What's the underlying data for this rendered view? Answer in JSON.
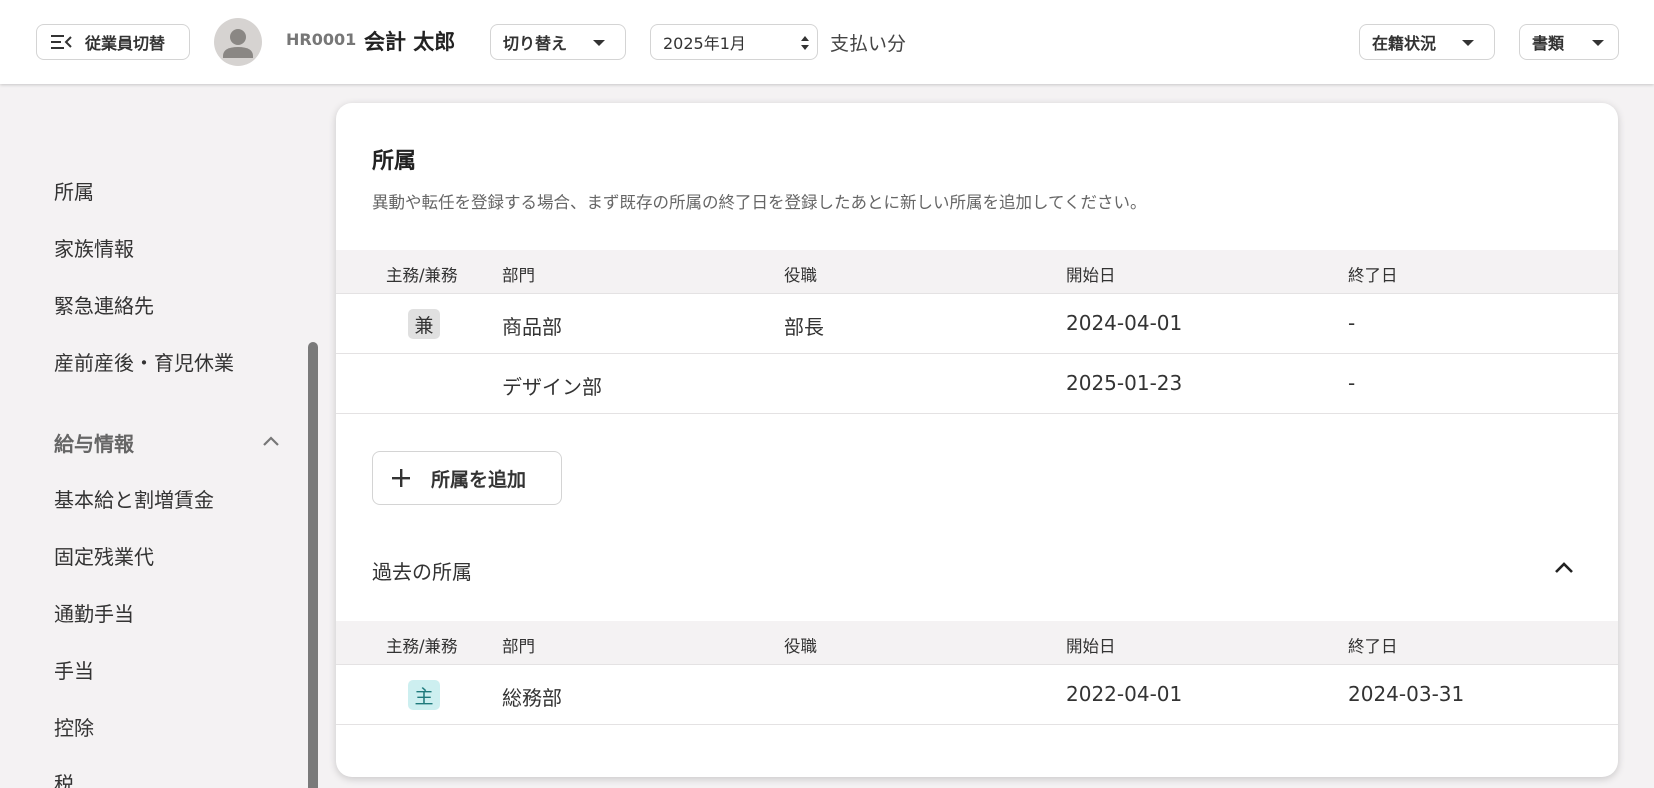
{
  "header": {
    "switch_employee_label": "従業員切替",
    "employee_code": "HR0001",
    "employee_name": "会計 太郎",
    "switch_label": "切り替え",
    "month_value": "2025年1月",
    "pay_label": "支払い分",
    "status_label": "在籍状況",
    "docs_label": "書類"
  },
  "sidebar": {
    "items_top": [
      "所属",
      "家族情報",
      "緊急連絡先",
      "産前産後・育児休業"
    ],
    "section_title": "給与情報",
    "items_pay": [
      "基本給と割増賃金",
      "固定残業代",
      "通勤手当",
      "手当",
      "控除",
      "税"
    ]
  },
  "main": {
    "title": "所属",
    "description": "異動や転任を登録する場合、まず既存の所属の終了日を登録したあとに新しい所属を追加してください。",
    "columns": [
      "主務/兼務",
      "部門",
      "役職",
      "開始日",
      "終了日"
    ],
    "rows": [
      {
        "type": "兼",
        "dept": "商品部",
        "role": "部長",
        "start": "2024-04-01",
        "end": "-"
      },
      {
        "type": "",
        "dept": "デザイン部",
        "role": "",
        "start": "2025-01-23",
        "end": "-"
      }
    ],
    "add_button_label": "所属を追加",
    "past_title": "過去の所属",
    "past_columns": [
      "主務/兼務",
      "部門",
      "役職",
      "開始日",
      "終了日"
    ],
    "past_rows": [
      {
        "type": "主",
        "dept": "総務部",
        "role": "",
        "start": "2022-04-01",
        "end": "2024-03-31"
      }
    ]
  },
  "colors": {
    "background": "#f4f2f3",
    "badge_concurrent": "#e0e0e0",
    "badge_primary": "#cdeff0",
    "badge_primary_text": "#1f7a7c"
  }
}
